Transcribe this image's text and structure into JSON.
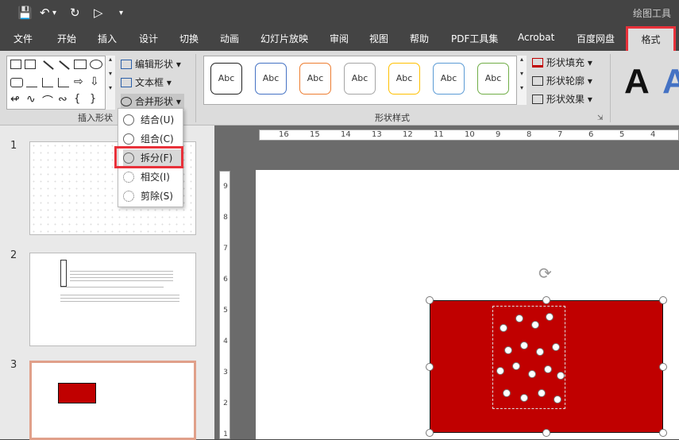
{
  "context_tab_group": "绘图工具",
  "tabs": [
    "文件",
    "开始",
    "插入",
    "设计",
    "切换",
    "动画",
    "幻灯片放映",
    "审阅",
    "视图",
    "帮助",
    "PDF工具集",
    "Acrobat",
    "百度网盘"
  ],
  "active_tab": "格式",
  "ribbon": {
    "edit_shape": "编辑形状",
    "text_box": "文本框",
    "merge_shapes": "合并形状",
    "insert_shapes_group": "插入形状",
    "shape_styles_group": "形状样式",
    "style_sample": "Abc",
    "shape_fill": "形状填充",
    "shape_outline": "形状轮廓",
    "shape_effects": "形状效果",
    "wordart_letter": "A"
  },
  "merge_menu": {
    "union": "结合(U)",
    "combine": "组合(C)",
    "fragment": "拆分(F)",
    "intersect": "相交(I)",
    "subtract": "剪除(S)"
  },
  "slides": {
    "n1": "1",
    "n2": "2",
    "n3": "3"
  },
  "ruler": {
    "h": [
      "16",
      "15",
      "14",
      "13",
      "12",
      "11",
      "10",
      "9",
      "8",
      "7",
      "6",
      "5",
      "4"
    ],
    "v": [
      "9",
      "8",
      "7",
      "6",
      "5",
      "4",
      "3",
      "2",
      "1"
    ]
  },
  "colors": {
    "shape_fill": "#c00000",
    "highlight": "#e8313a"
  }
}
